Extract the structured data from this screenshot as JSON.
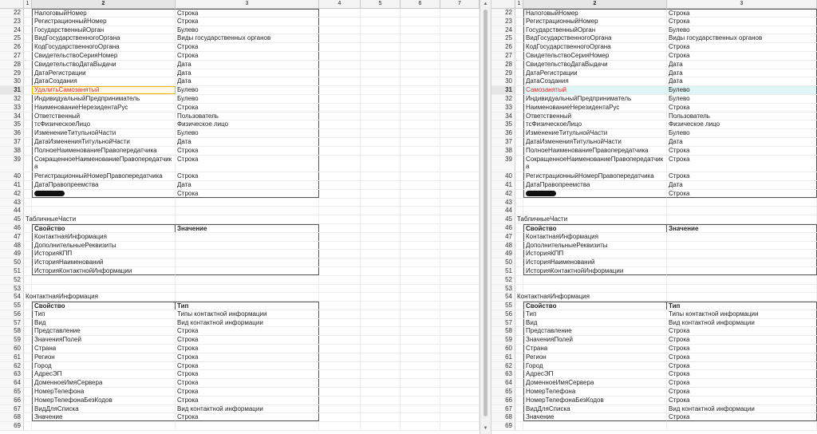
{
  "left": {
    "columns": [
      "",
      "1",
      "2",
      "3",
      "4",
      "5",
      "6",
      "7"
    ],
    "rows": [
      {
        "n": "22",
        "c2": "НалоговыйНомер",
        "c3": "Строка"
      },
      {
        "n": "23",
        "c2": "РегистрационныйНомер",
        "c3": "Строка"
      },
      {
        "n": "24",
        "c2": "ГосударственныйОрган",
        "c3": "Булево"
      },
      {
        "n": "25",
        "c2": "ВидГосударственногоОргана",
        "c3": "Виды государственных органов"
      },
      {
        "n": "26",
        "c2": "КодГосударственногоОргана",
        "c3": "Строка"
      },
      {
        "n": "27",
        "c2": "СвидетельствоСерияНомер",
        "c3": "Строка"
      },
      {
        "n": "28",
        "c2": "СвидетельствоДатаВыдачи",
        "c3": "Дата"
      },
      {
        "n": "29",
        "c2": "ДатаРегистрации",
        "c3": "Дата"
      },
      {
        "n": "30",
        "c2": "ДатаСоздания",
        "c3": "Дата"
      },
      {
        "n": "31",
        "c2": "УдалитьСамозанятый",
        "c3": "Булево"
      },
      {
        "n": "32",
        "c2": "ИндивидуальныйПредприниматель",
        "c3": "Булево"
      },
      {
        "n": "33",
        "c2": "НаименованиеНерезидентаРус",
        "c3": "Строка"
      },
      {
        "n": "34",
        "c2": "Ответственный",
        "c3": "Пользователь"
      },
      {
        "n": "35",
        "c2": "тсФизическоеЛицо",
        "c3": "Физическое лицо"
      },
      {
        "n": "36",
        "c2": "ИзменениеТитульнойЧасти",
        "c3": "Булево"
      },
      {
        "n": "37",
        "c2": "ДатаИзмененияТитульнойЧасти",
        "c3": "Дата"
      },
      {
        "n": "38",
        "c2": "ПолноеНаименованиеПравопередатчика",
        "c3": "Строка"
      },
      {
        "n": "39",
        "c2": "СокращенноеНаименованиеПравопередатчика",
        "c3": "Строка"
      },
      {
        "n": "40",
        "c2": "РегистрационныйНомерПравопередатчика",
        "c3": "Строка"
      },
      {
        "n": "41",
        "c2": "ДатаПравопреемства",
        "c3": "Дата"
      },
      {
        "n": "42",
        "c2": "",
        "c3": "Строка"
      },
      {
        "n": "43",
        "c1": "",
        "c2": "",
        "c3": ""
      },
      {
        "n": "44",
        "c1": "",
        "c2": "",
        "c3": ""
      },
      {
        "n": "45",
        "c1": "ТабличныеЧасти",
        "c2": "",
        "c3": ""
      },
      {
        "n": "46",
        "c2": "Свойство",
        "c3": "Значение"
      },
      {
        "n": "47",
        "c2": "КонтактнаяИнформация",
        "c3": ""
      },
      {
        "n": "48",
        "c2": "ДополнительныеРеквизиты",
        "c3": ""
      },
      {
        "n": "49",
        "c2": "ИсторияКПП",
        "c3": ""
      },
      {
        "n": "50",
        "c2": "ИсторияНаименований",
        "c3": ""
      },
      {
        "n": "51",
        "c2": "ИсторияКонтактнойИнформации",
        "c3": ""
      },
      {
        "n": "52",
        "c1": "",
        "c2": "",
        "c3": ""
      },
      {
        "n": "53",
        "c1": "",
        "c2": "",
        "c3": ""
      },
      {
        "n": "54",
        "c1": "КонтактнаяИнформация",
        "c2": "",
        "c3": ""
      },
      {
        "n": "55",
        "c2": "Свойство",
        "c3": "Тип"
      },
      {
        "n": "56",
        "c2": "Тип",
        "c3": "Типы контактной информации"
      },
      {
        "n": "57",
        "c2": "Вид",
        "c3": "Вид контактной информации"
      },
      {
        "n": "58",
        "c2": "Представление",
        "c3": "Строка"
      },
      {
        "n": "59",
        "c2": "ЗначенияПолей",
        "c3": "Строка"
      },
      {
        "n": "60",
        "c2": "Страна",
        "c3": "Строка"
      },
      {
        "n": "61",
        "c2": "Регион",
        "c3": "Строка"
      },
      {
        "n": "62",
        "c2": "Город",
        "c3": "Строка"
      },
      {
        "n": "63",
        "c2": "АдресЭП",
        "c3": "Строка"
      },
      {
        "n": "64",
        "c2": "ДоменноеИмяСервера",
        "c3": "Строка"
      },
      {
        "n": "65",
        "c2": "НомерТелефона",
        "c3": "Строка"
      },
      {
        "n": "66",
        "c2": "НомерТелефонаБезКодов",
        "c3": "Строка"
      },
      {
        "n": "67",
        "c2": "ВидДляСписка",
        "c3": "Вид контактной информации"
      },
      {
        "n": "68",
        "c2": "Значение",
        "c3": "Строка"
      },
      {
        "n": "69",
        "c2": "",
        "c3": ""
      }
    ]
  },
  "right": {
    "columns": [
      "",
      "1",
      "2",
      "3"
    ],
    "rows": [
      {
        "n": "22",
        "c2": "НалоговыйНомер",
        "c3": "Строка"
      },
      {
        "n": "23",
        "c2": "РегистрационныйНомер",
        "c3": "Строка"
      },
      {
        "n": "24",
        "c2": "ГосударственныйОрган",
        "c3": "Булево"
      },
      {
        "n": "25",
        "c2": "ВидГосударственногоОргана",
        "c3": "Виды государственных органов"
      },
      {
        "n": "26",
        "c2": "КодГосударственногоОргана",
        "c3": "Строка"
      },
      {
        "n": "27",
        "c2": "СвидетельствоСерияНомер",
        "c3": "Строка"
      },
      {
        "n": "28",
        "c2": "СвидетельствоДатаВыдачи",
        "c3": "Дата"
      },
      {
        "n": "29",
        "c2": "ДатаРегистрации",
        "c3": "Дата"
      },
      {
        "n": "30",
        "c2": "ДатаСоздания",
        "c3": "Дата"
      },
      {
        "n": "31",
        "c2": "Самозанятый",
        "c3": "Булево"
      },
      {
        "n": "32",
        "c2": "ИндивидуальныйПредприниматель",
        "c3": "Булево"
      },
      {
        "n": "33",
        "c2": "НаименованиеНерезидентаРус",
        "c3": "Строка"
      },
      {
        "n": "34",
        "c2": "Ответственный",
        "c3": "Пользователь"
      },
      {
        "n": "35",
        "c2": "тсФизическоеЛицо",
        "c3": "Физическое лицо"
      },
      {
        "n": "36",
        "c2": "ИзменениеТитульнойЧасти",
        "c3": "Булево"
      },
      {
        "n": "37",
        "c2": "ДатаИзмененияТитульнойЧасти",
        "c3": "Дата"
      },
      {
        "n": "38",
        "c2": "ПолноеНаименованиеПравопередатчика",
        "c3": "Строка"
      },
      {
        "n": "39",
        "c2": "СокращенноеНаименованиеПравопередатчика",
        "c3": "Строка"
      },
      {
        "n": "40",
        "c2": "РегистрационныйНомерПравопередатчика",
        "c3": "Строка"
      },
      {
        "n": "41",
        "c2": "ДатаПравопреемства",
        "c3": "Дата"
      },
      {
        "n": "42",
        "c2": "",
        "c3": "Строка"
      },
      {
        "n": "43",
        "c1": "",
        "c2": "",
        "c3": ""
      },
      {
        "n": "44",
        "c1": "",
        "c2": "",
        "c3": ""
      },
      {
        "n": "45",
        "c1": "ТабличныеЧасти",
        "c2": "",
        "c3": ""
      },
      {
        "n": "46",
        "c2": "Свойство",
        "c3": "Значение"
      },
      {
        "n": "47",
        "c2": "КонтактнаяИнформация",
        "c3": ""
      },
      {
        "n": "48",
        "c2": "ДополнительныеРеквизиты",
        "c3": ""
      },
      {
        "n": "49",
        "c2": "ИсторияКПП",
        "c3": ""
      },
      {
        "n": "50",
        "c2": "ИсторияНаименований",
        "c3": ""
      },
      {
        "n": "51",
        "c2": "ИсторияКонтактнойИнформации",
        "c3": ""
      },
      {
        "n": "52",
        "c1": "",
        "c2": "",
        "c3": ""
      },
      {
        "n": "53",
        "c1": "",
        "c2": "",
        "c3": ""
      },
      {
        "n": "54",
        "c1": "КонтактнаяИнформация",
        "c2": "",
        "c3": ""
      },
      {
        "n": "55",
        "c2": "Свойство",
        "c3": "Тип"
      },
      {
        "n": "56",
        "c2": "Тип",
        "c3": "Типы контактной информации"
      },
      {
        "n": "57",
        "c2": "Вид",
        "c3": "Вид контактной информации"
      },
      {
        "n": "58",
        "c2": "Представление",
        "c3": "Строка"
      },
      {
        "n": "59",
        "c2": "ЗначенияПолей",
        "c3": "Строка"
      },
      {
        "n": "60",
        "c2": "Страна",
        "c3": "Строка"
      },
      {
        "n": "61",
        "c2": "Регион",
        "c3": "Строка"
      },
      {
        "n": "62",
        "c2": "Город",
        "c3": "Строка"
      },
      {
        "n": "63",
        "c2": "АдресЭП",
        "c3": "Строка"
      },
      {
        "n": "64",
        "c2": "ДоменноеИмяСервера",
        "c3": "Строка"
      },
      {
        "n": "65",
        "c2": "НомерТелефона",
        "c3": "Строка"
      },
      {
        "n": "66",
        "c2": "НомерТелефонаБезКодов",
        "c3": "Строка"
      },
      {
        "n": "67",
        "c2": "ВидДляСписка",
        "c3": "Вид контактной информации"
      },
      {
        "n": "68",
        "c2": "Значение",
        "c3": "Строка"
      },
      {
        "n": "69",
        "c2": "",
        "c3": ""
      }
    ]
  },
  "scrollbar": {
    "up_icon": "arrow-up-icon",
    "down_icon": "arrow-down-icon"
  }
}
